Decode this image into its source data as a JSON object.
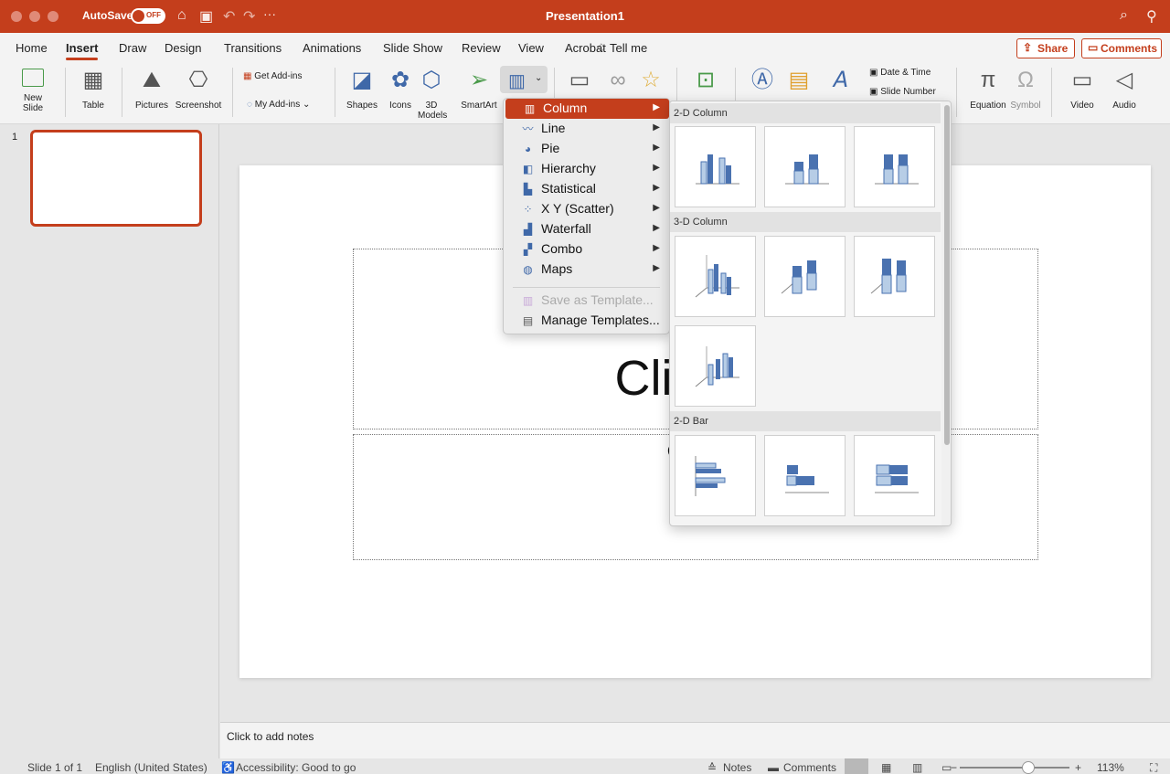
{
  "titlebar": {
    "autosave_label": "AutoSave",
    "autosave_state": "OFF",
    "more": "···",
    "title": "Presentation1",
    "search_glyph": "⌕",
    "share_glyph": "⚲"
  },
  "tabs": [
    {
      "label": "Home"
    },
    {
      "label": "Insert"
    },
    {
      "label": "Draw"
    },
    {
      "label": "Design"
    },
    {
      "label": "Transitions"
    },
    {
      "label": "Animations"
    },
    {
      "label": "Slide Show"
    },
    {
      "label": "Review"
    },
    {
      "label": "View"
    },
    {
      "label": "Acrobat"
    }
  ],
  "tell_me": "Tell me",
  "share": "Share",
  "comments": "Comments",
  "ribbon": {
    "new_slide": "New\nSlide",
    "new_slide_1": "New",
    "new_slide_2": "Slide",
    "table": "Table",
    "pictures": "Pictures",
    "screenshot": "Screenshot",
    "get_addins": "Get Add-ins",
    "my_addins": "My Add-ins ⌄",
    "shapes": "Shapes",
    "icons": "Icons",
    "models_1": "3D",
    "models_2": "Models",
    "smartart": "SmartArt",
    "date_time": "Date & Time",
    "slide_number": "Slide Number",
    "equation": "Equation",
    "symbol": "Symbol",
    "video": "Video",
    "audio": "Audio"
  },
  "thumbs": {
    "slide_number": "1"
  },
  "slide": {
    "title_placeholder": "Click to",
    "subtitle_placeholder": "Click to"
  },
  "notes": "Click to add notes",
  "status": {
    "slide_info": "Slide 1 of 1",
    "language": "English (United States)",
    "accessibility": "Accessibility: Good to go",
    "notes": "Notes",
    "comments": "Comments",
    "zoom": "113%"
  },
  "chart_menu": {
    "items": [
      {
        "label": "Column",
        "icon": "column-chart-icon"
      },
      {
        "label": "Line",
        "icon": "line-chart-icon"
      },
      {
        "label": "Pie",
        "icon": "pie-chart-icon"
      },
      {
        "label": "Hierarchy",
        "icon": "hierarchy-chart-icon"
      },
      {
        "label": "Statistical",
        "icon": "statistical-chart-icon"
      },
      {
        "label": "X Y (Scatter)",
        "icon": "scatter-chart-icon"
      },
      {
        "label": "Waterfall",
        "icon": "waterfall-chart-icon"
      },
      {
        "label": "Combo",
        "icon": "combo-chart-icon"
      },
      {
        "label": "Maps",
        "icon": "maps-chart-icon"
      }
    ],
    "save_template": "Save as Template...",
    "manage_templates": "Manage Templates..."
  },
  "gallery": {
    "sections": [
      "2-D Column",
      "3-D Column",
      "2-D Bar"
    ]
  },
  "colors": {
    "accent": "#c43e1c",
    "chart_dark": "#4a72b0",
    "chart_light": "#b7cde6"
  }
}
